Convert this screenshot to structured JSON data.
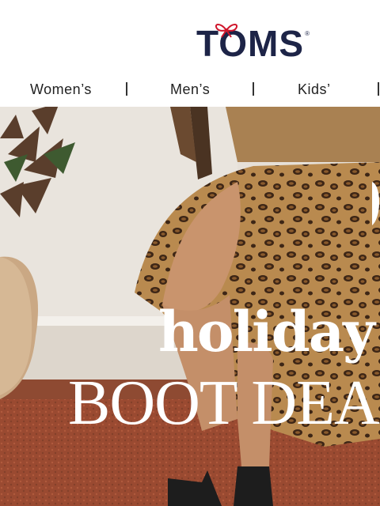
{
  "header": {
    "logo_text": "TOMS",
    "logo_mark": "®"
  },
  "nav": {
    "items": [
      {
        "label": "Women’s"
      },
      {
        "label": "Men’s"
      },
      {
        "label": "Kids’"
      }
    ]
  },
  "hero": {
    "headline_1": "holiday",
    "headline_2": "BOOT DEALS"
  },
  "colors": {
    "brand_navy": "#1d2447",
    "brand_red": "#d0152b",
    "hero_text": "#ffffff"
  }
}
